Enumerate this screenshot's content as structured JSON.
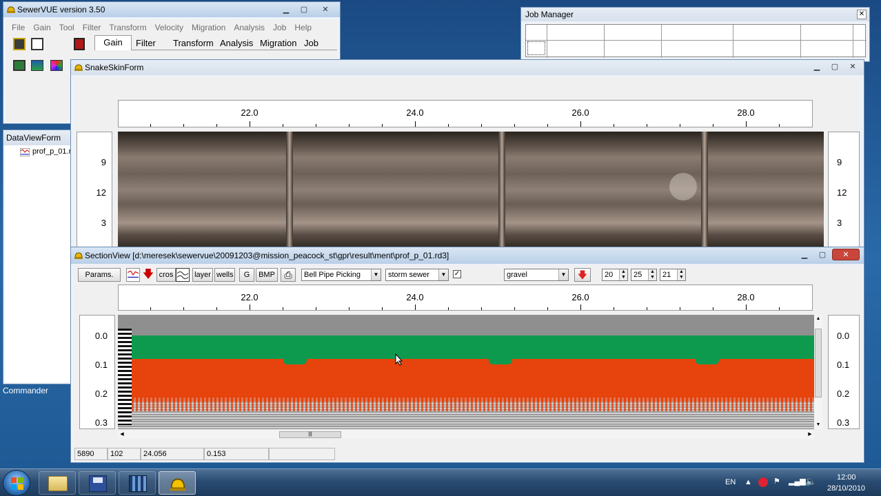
{
  "main_window": {
    "title": "SewerVUE version 3.50",
    "menu": [
      "File",
      "Gain",
      "Tool",
      "Filter",
      "Transform",
      "Velocity",
      "Migration",
      "Analysis",
      "Job",
      "Help"
    ],
    "tabs": [
      "Gain",
      "Filter",
      "Transform",
      "Analysis",
      "Migration",
      "Job"
    ]
  },
  "data_view": {
    "title": "DataViewForm",
    "item": "prof_p_01.r"
  },
  "commander": {
    "label": "Commander"
  },
  "job_manager": {
    "title": "Job Manager"
  },
  "snakeskin": {
    "title": "SnakeSkinForm",
    "ruler_ticks": [
      "22.0",
      "24.0",
      "26.0",
      "28.0"
    ],
    "left_labels": [
      "9",
      "12",
      "3"
    ],
    "right_labels": [
      "9",
      "12",
      "3"
    ]
  },
  "section_view": {
    "title": "SectionView [d:\\meresek\\sewervue\\20091203@mission_peacock_st\\gpr\\result\\ment\\prof_p_01.rd3]",
    "toolbar": {
      "params": "Params.",
      "cros": "cros",
      "layer": "layer",
      "wells": "wells",
      "g": "G",
      "bmp": "BMP",
      "picking_mode": "Bell Pipe Picking",
      "pipe_type": "storm sewer",
      "material": "gravel",
      "spin1": "20",
      "spin2": "25",
      "spin3": "21"
    },
    "ruler_ticks": [
      "22.0",
      "24.0",
      "26.0",
      "28.0"
    ],
    "depth_labels": [
      "0.0",
      "0.1",
      "0.2",
      "0.3"
    ],
    "colors": {
      "layer_top": "#0e9a4e",
      "layer_bottom": "#ea3d04"
    }
  },
  "status_bar": {
    "v1": "5890",
    "v2": "102",
    "v3": "24.056",
    "v4": "0.153"
  },
  "taskbar": {
    "lang": "EN",
    "time": "12:00",
    "date": "28/10/2010"
  }
}
